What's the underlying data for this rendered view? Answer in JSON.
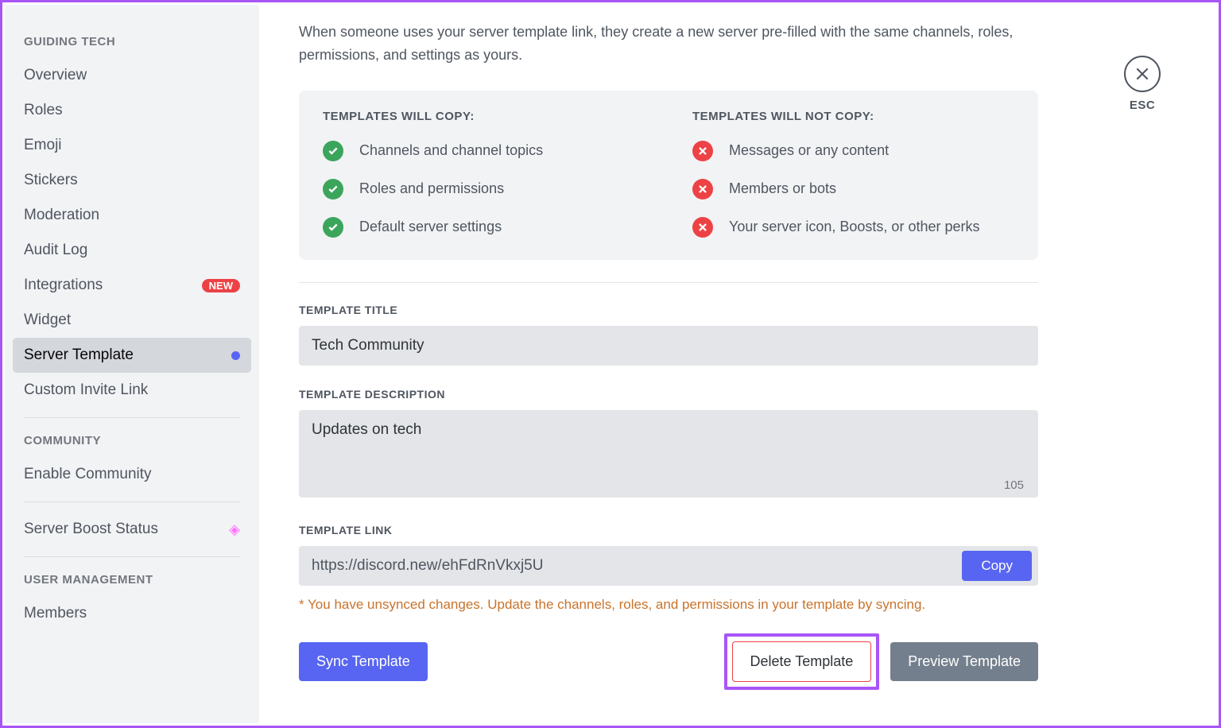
{
  "sidebar": {
    "sections": [
      {
        "header": "GUIDING TECH",
        "items": [
          {
            "label": "Overview"
          },
          {
            "label": "Roles"
          },
          {
            "label": "Emoji"
          },
          {
            "label": "Stickers"
          },
          {
            "label": "Moderation"
          },
          {
            "label": "Audit Log"
          },
          {
            "label": "Integrations",
            "badge": "NEW"
          },
          {
            "label": "Widget"
          },
          {
            "label": "Server Template",
            "active": true,
            "dot": true
          },
          {
            "label": "Custom Invite Link"
          }
        ]
      },
      {
        "header": "COMMUNITY",
        "items": [
          {
            "label": "Enable Community"
          }
        ]
      },
      {
        "boost_item": {
          "label": "Server Boost Status"
        }
      },
      {
        "header": "USER MANAGEMENT",
        "items": [
          {
            "label": "Members"
          }
        ]
      }
    ]
  },
  "close": {
    "label": "ESC"
  },
  "intro": "When someone uses your server template link, they create a new server pre-filled with the same channels, roles, permissions, and settings as yours.",
  "card": {
    "will_title": "TEMPLATES WILL COPY:",
    "will_items": [
      "Channels and channel topics",
      "Roles and permissions",
      "Default server settings"
    ],
    "wont_title": "TEMPLATES WILL NOT COPY:",
    "wont_items": [
      "Messages or any content",
      "Members or bots",
      "Your server icon, Boosts, or other perks"
    ]
  },
  "fields": {
    "title_label": "TEMPLATE TITLE",
    "title_value": "Tech Community",
    "desc_label": "TEMPLATE DESCRIPTION",
    "desc_value": "Updates on tech",
    "char_count": "105",
    "link_label": "TEMPLATE LINK",
    "link_value": "https://discord.new/ehFdRnVkxj5U",
    "copy_btn": "Copy"
  },
  "warning": "* You have unsynced changes. Update the channels, roles, and permissions in your template by syncing.",
  "buttons": {
    "sync": "Sync Template",
    "delete": "Delete Template",
    "preview": "Preview Template"
  }
}
